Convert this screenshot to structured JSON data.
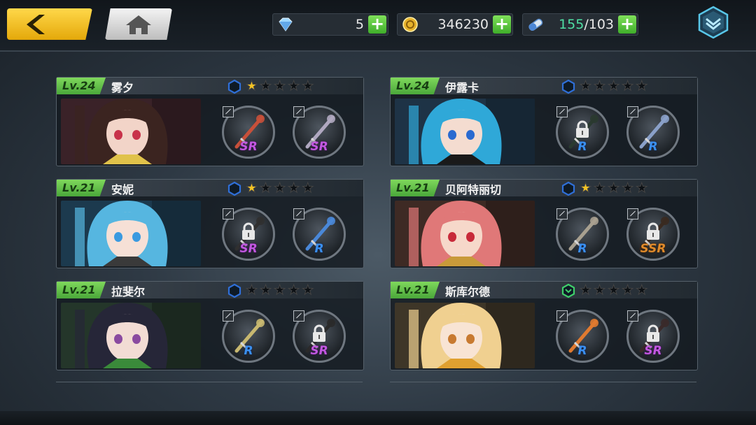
{
  "topbar": {
    "back_icon": "chevron-left-icon",
    "home_icon": "home-icon",
    "diamonds": {
      "icon": "diamond-icon",
      "value": "5"
    },
    "gold": {
      "icon": "coin-icon",
      "value": "346230"
    },
    "stamina": {
      "icon": "stamina-pill-icon",
      "current": "155",
      "sep_max": "/103"
    },
    "plus": "+",
    "menu_icon": "chevron-down-menu-icon"
  },
  "characters": [
    {
      "level": "Lv.24",
      "name": "雾夕",
      "rank_color": "#2f6fd8",
      "stars": 1,
      "slots": [
        {
          "rarity": "SR",
          "locked": false
        },
        {
          "rarity": "SR",
          "locked": false
        }
      ]
    },
    {
      "level": "Lv.24",
      "name": "伊露卡",
      "rank_color": "#2f6fd8",
      "stars": 0,
      "slots": [
        {
          "rarity": "R",
          "locked": true
        },
        {
          "rarity": "R",
          "locked": false
        }
      ]
    },
    {
      "level": "Lv.21",
      "name": "安妮",
      "rank_color": "#2f6fd8",
      "stars": 1,
      "slots": [
        {
          "rarity": "SR",
          "locked": true
        },
        {
          "rarity": "R",
          "locked": false
        }
      ]
    },
    {
      "level": "Lv.21",
      "name": "贝阿特丽切",
      "rank_color": "#2f6fd8",
      "stars": 1,
      "slots": [
        {
          "rarity": "R",
          "locked": false
        },
        {
          "rarity": "SSR",
          "locked": true
        }
      ]
    },
    {
      "level": "Lv.21",
      "name": "拉斐尔",
      "rank_color": "#2f6fd8",
      "stars": 0,
      "slots": [
        {
          "rarity": "R",
          "locked": false
        },
        {
          "rarity": "SR",
          "locked": true
        }
      ]
    },
    {
      "level": "Lv.21",
      "name": "斯库尔德",
      "rank_color": "#3fcf6a",
      "stars": 0,
      "slots": [
        {
          "rarity": "R",
          "locked": false
        },
        {
          "rarity": "SR",
          "locked": true
        }
      ]
    }
  ],
  "colors": {
    "level_badge": "#5cbd45",
    "star_on": "#f3c324",
    "plus_button": "#4cc437",
    "sr": "#c257e0",
    "r": "#3a8ff0",
    "ssr": "#e08a2a"
  }
}
